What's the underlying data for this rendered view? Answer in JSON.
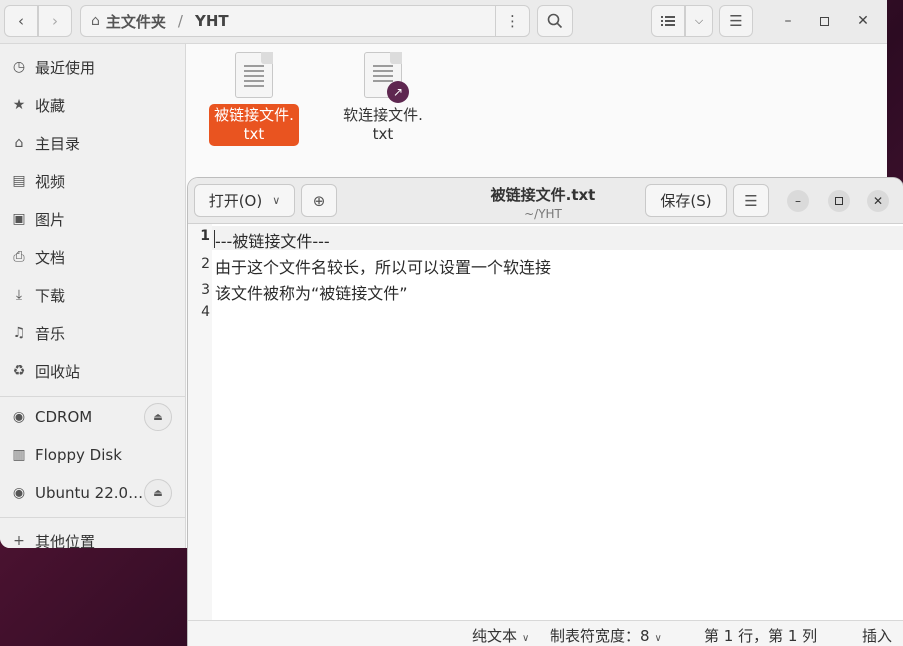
{
  "file_manager": {
    "path": {
      "home_label": "主文件夹",
      "separator": "/",
      "current": "YHT"
    },
    "sidebar": {
      "places": [
        {
          "label": "最近使用",
          "icon": "clock-icon"
        },
        {
          "label": "收藏",
          "icon": "star-icon"
        },
        {
          "label": "主目录",
          "icon": "home-icon"
        },
        {
          "label": "视频",
          "icon": "film-icon"
        },
        {
          "label": "图片",
          "icon": "image-icon"
        },
        {
          "label": "文档",
          "icon": "document-icon"
        },
        {
          "label": "下载",
          "icon": "download-icon"
        },
        {
          "label": "音乐",
          "icon": "music-icon"
        },
        {
          "label": "回收站",
          "icon": "trash-icon"
        }
      ],
      "devices": [
        {
          "label": "CDROM",
          "icon": "disc-icon",
          "ejectable": true
        },
        {
          "label": "Floppy Disk",
          "icon": "drive-icon",
          "ejectable": false
        },
        {
          "label": "Ubuntu 22.0…",
          "icon": "disc-icon",
          "ejectable": true
        }
      ],
      "other": {
        "label": "其他位置",
        "icon": "plus-icon"
      }
    },
    "files": [
      {
        "name_line1": "被链接文件.",
        "name_line2": "txt",
        "selected": true,
        "is_link": false
      },
      {
        "name_line1": "软连接文件.",
        "name_line2": "txt",
        "selected": false,
        "is_link": true
      }
    ]
  },
  "editor": {
    "open_label": "打开(O)",
    "save_label": "保存(S)",
    "title": "被链接文件.txt",
    "subtitle": "~/YHT",
    "lines": [
      {
        "number": "1",
        "text": "---被链接文件---"
      },
      {
        "number": "2",
        "text": "由于这个文件名较长，所以可以设置一个软连接"
      },
      {
        "number": "3",
        "text": "该文件被称为“被链接文件”"
      },
      {
        "number": "4",
        "text": ""
      }
    ],
    "status": {
      "language": "纯文本",
      "tab_width": "制表符宽度：8",
      "position": "第 1 行，第 1 列",
      "mode": "插入"
    }
  },
  "colors": {
    "accent": "#e95420",
    "link_badge": "#5e2750"
  }
}
